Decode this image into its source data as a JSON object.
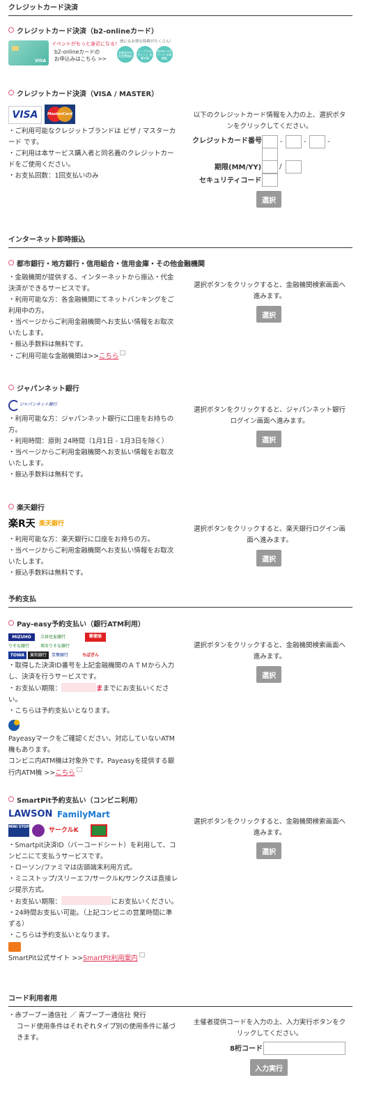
{
  "credit": {
    "section_title": "クレジットカード決済",
    "b2": {
      "heading": "クレジットカード決済（b2-onlineカード）",
      "banner_tag": "イベントがもっと身近になる！",
      "banner_text1": "b2-onlineカードの",
      "banner_text2": "お申込みはこちら >>",
      "banner_headline": "他にもお得な特典がたくさん！",
      "circles": [
        "会員会社の\n年会費無料",
        "イープラス\nポイント\n加算対象",
        "Ponta\nパスワード\nの新機能"
      ],
      "card_brand": "VISA"
    },
    "visa": {
      "heading": "クレジットカード決済（VISA / MASTER）",
      "logo_visa": "VISA",
      "logo_master": "MasterCard",
      "desc": [
        "・ご利用可能なクレジットブランドは ビザ / マスターカード です。",
        "・ご利用は本サービス購入者と同名義のクレジットカードをご使用ください。",
        "・お支払回数：1回支払いのみ"
      ],
      "instruction": "以下のクレジットカード情報を入力の上、選択ボタンをクリックしてください。",
      "card_number_label": "クレジットカード番号",
      "dash": "-",
      "expiry_label": "期限(MM/YY)",
      "slash": "/",
      "security_label": "セキュリティコード",
      "select": "選択"
    }
  },
  "netbank": {
    "section_title": "インターネット即時振込",
    "city": {
      "heading": "都市銀行・地方銀行・信用組合・信用金庫・その他金融機関",
      "desc": [
        "・金融機関が提供する、インターネットから振込・代金決済ができるサービスです。",
        "・利用可能な方：各金融機関にてネットバンキングをご利用中の方。",
        "・当ページからご利用金融機関へお支払い情報をお取次いたします。",
        "・振込手数料は無料です。"
      ],
      "link_prefix": "・ご利用可能な金融機関は>>",
      "link": "こちら",
      "instruction": "選択ボタンをクリックすると、金融機関検索画面へ進みます。",
      "select": "選択"
    },
    "japannet": {
      "heading": "ジャパンネット銀行",
      "logo": "ジャパンネット銀行",
      "desc": [
        "・利用可能な方：ジャパンネット銀行に口座をお持ちの方。",
        "・利用時間：原則 24時間（1月1日 - 1月3日を除く）",
        "・当ページからご利用金融機関へお支払い情報をお取次いたします。",
        "・振込手数料は無料です。"
      ],
      "instruction": "選択ボタンをクリックすると、ジャパンネット銀行ログイン画面へ進みます。",
      "select": "選択"
    },
    "rakuten": {
      "heading": "楽天銀行",
      "logo_main": "楽R天",
      "logo_sub": "楽天銀行",
      "desc": [
        "・利用可能な方：楽天銀行に口座をお持ちの方。",
        "・当ページからご利用金融機関へお支払い情報をお取次いたします。",
        "・振込手数料は無料です。"
      ],
      "instruction": "選択ボタンをクリックすると、楽天銀行ログイン画面へ進みます。",
      "select": "選択"
    }
  },
  "reserve": {
    "section_title": "予約支払",
    "payeasy": {
      "heading": "Pay-easy予約支払い（銀行ATM利用）",
      "banks": [
        "MIZUHO",
        "三井住友銀行",
        "郵便局",
        "りそな銀行",
        "埼玉りそな銀行",
        "TOWA",
        "東和銀行",
        "京葉銀行",
        "ちばぎん"
      ],
      "desc": [
        "・取得した決済ID番号を上記金融機関のＡＴＭから入力し、決済を行うサービスです。"
      ],
      "deadline_prefix": "・お支払い期限：",
      "deadline_suffix": "までにお支払いください。",
      "note": "・こちらは予約支払いとなります。",
      "mark_desc": "Payeasyマークをご確認ください。対応していないATM機もあります。",
      "atm_desc_prefix": "コンビニ内ATM機は対象外です。Payeasyを提供する銀行内ATM機 >>",
      "link": "こちら",
      "instruction": "選択ボタンをクリックすると、金融機関検索画面へ進みます。",
      "select": "選択"
    },
    "smartpit": {
      "heading": "SmartPit予約支払い（コンビニ利用）",
      "logo_lawson": "LAWSON",
      "logo_family": "FamilyMart",
      "logo_ministop": "MINI STOP",
      "logo_circlek": "サークルK",
      "desc": [
        "・Smartpit決済ID（バーコードシート）を利用して、コンビニにて支払うサービスです。",
        "・ローソン/ファミマは店頭端末利用方式。",
        "・ミニストップ/スリーエフ/サークルK/サンクスは直接レジ提示方式。"
      ],
      "deadline_prefix": "・お支払い期限：",
      "deadline_suffix": "にお支払いください。",
      "desc2": [
        "・24時間お支払い可能。（上記コンビニの営業時間に準ずる）",
        "・こちらは予約支払いとなります。"
      ],
      "site_prefix": "SmartPit公式サイト >>",
      "site_link": "SmartPit利用案内",
      "instruction": "選択ボタンをクリックすると、金融機関検索画面へ進みます。",
      "select": "選択"
    }
  },
  "code": {
    "section_title": "コード利用者用",
    "desc1": "・赤ブーブー通信社 ／ 青ブーブー通信社 発行",
    "desc2": "コード使用条件はそれぞれタイプ別の使用条件に基づきます。",
    "instruction": "主催者提供コードを入力の上、入力実行ボタンをクリックしてください。",
    "code_label": "8桁コード",
    "submit": "入力実行"
  }
}
